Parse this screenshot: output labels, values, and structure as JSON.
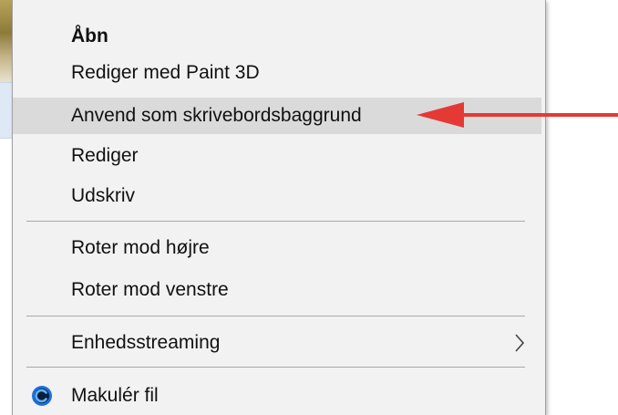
{
  "colors": {
    "menu_bg": "#f2f2f2",
    "highlight_bg": "#dadada",
    "separator": "#a9a9a9",
    "annotation_arrow": "#e53935",
    "ccleaner_blue": "#1e6fd9"
  },
  "menu": {
    "items": [
      {
        "label": "Åbn",
        "bold": true,
        "highlighted": false
      },
      {
        "label": "Rediger med Paint 3D",
        "bold": false,
        "highlighted": false
      },
      {
        "label": "Anvend som skrivebordsbaggrund",
        "bold": false,
        "highlighted": true
      },
      {
        "label": "Rediger",
        "bold": false,
        "highlighted": false
      },
      {
        "label": "Udskriv",
        "bold": false,
        "highlighted": false
      },
      {
        "label": "Roter mod højre",
        "bold": false,
        "highlighted": false
      },
      {
        "label": "Roter mod venstre",
        "bold": false,
        "highlighted": false
      },
      {
        "label": "Enhedsstreaming",
        "bold": false,
        "highlighted": false,
        "submenu": true
      },
      {
        "label": "Makulér fil",
        "bold": false,
        "highlighted": false,
        "icon": "ccleaner-icon"
      }
    ]
  },
  "annotation": {
    "icon": "red-arrow-pointing-left"
  }
}
